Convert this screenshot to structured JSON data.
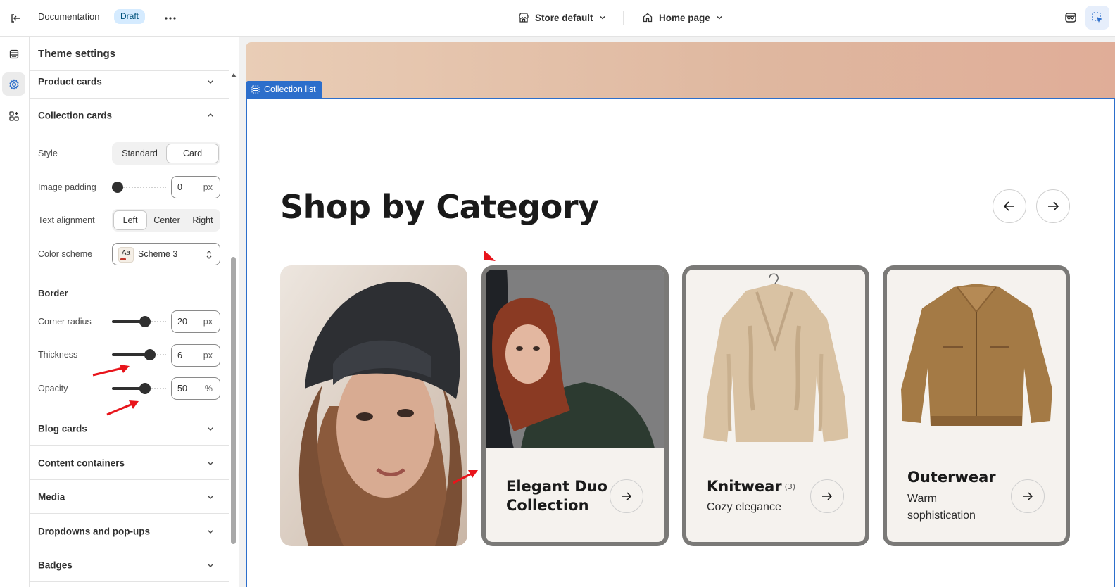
{
  "topbar": {
    "doc_title": "Documentation",
    "status_badge": "Draft",
    "store": "Store default",
    "page": "Home page"
  },
  "panel": {
    "title": "Theme settings",
    "sections": {
      "product_cards": "Product cards",
      "collection_cards": "Collection cards",
      "blog_cards": "Blog cards",
      "content_containers": "Content containers",
      "media": "Media",
      "dropdowns": "Dropdowns and pop-ups",
      "badges": "Badges"
    },
    "style": {
      "label": "Style",
      "options": [
        "Standard",
        "Card"
      ],
      "selected": "Card"
    },
    "image_padding": {
      "label": "Image padding",
      "value": "0",
      "unit": "px",
      "level": 0
    },
    "text_alignment": {
      "label": "Text alignment",
      "options": [
        "Left",
        "Center",
        "Right"
      ],
      "selected": "Left"
    },
    "color_scheme": {
      "label": "Color scheme",
      "swatch": "Aa",
      "value": "Scheme 3"
    },
    "border": {
      "title": "Border",
      "corner_radius": {
        "label": "Corner radius",
        "value": "20",
        "unit": "px",
        "level": 0.5
      },
      "thickness": {
        "label": "Thickness",
        "value": "6",
        "unit": "px",
        "level": 0.6
      },
      "opacity": {
        "label": "Opacity",
        "value": "50",
        "unit": "%",
        "level": 0.5
      }
    }
  },
  "preview": {
    "section_tag": "Collection list",
    "heading": "Shop by Category",
    "cards": [
      {
        "title": "",
        "subtitle": ""
      },
      {
        "title": "Elegant Duo Collection",
        "subtitle": ""
      },
      {
        "title": "Knitwear",
        "count": "(3)",
        "subtitle": "Cozy elegance"
      },
      {
        "title": "Outerwear",
        "subtitle": "Warm sophistication"
      }
    ]
  },
  "colors": {
    "accent_blue": "#2c6ecb",
    "badge_bg": "#d5ebff",
    "card_bg": "#f5f2ee",
    "annotation_red": "#e8141b"
  }
}
